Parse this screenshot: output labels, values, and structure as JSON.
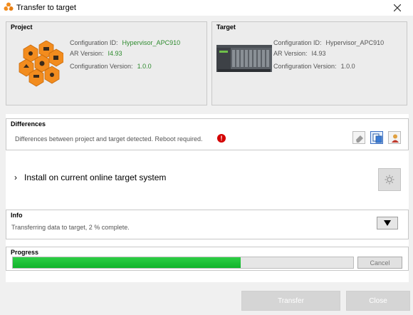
{
  "window": {
    "title": "Transfer to target"
  },
  "project": {
    "heading": "Project",
    "config_id_label": "Configuration ID:",
    "config_id_value": "Hypervisor_APC910",
    "ar_version_label": "AR Version:",
    "ar_version_value": "I4.93",
    "config_version_label": "Configuration Version:",
    "config_version_value": "1.0.0"
  },
  "target": {
    "heading": "Target",
    "config_id_label": "Configuration ID:",
    "config_id_value": "Hypervisor_APC910",
    "ar_version_label": "AR Version:",
    "ar_version_value": "I4.93",
    "config_version_label": "Configuration Version:",
    "config_version_value": "1.0.0"
  },
  "differences": {
    "heading": "Differences",
    "message": "Differences between project and target detected. Reboot required."
  },
  "install": {
    "chevron": "›",
    "label": "Install on current online target system"
  },
  "info": {
    "heading": "Info",
    "message": "Transferring data to target, 2 % complete."
  },
  "progress": {
    "heading": "Progress",
    "fill_fraction": 0.67,
    "cancel_label": "Cancel"
  },
  "buttons": {
    "transfer_label": "Transfer",
    "close_label": "Close"
  },
  "colors": {
    "progress_green": "#1dbf37",
    "accent_orange": "#f28c1e",
    "value_green": "#2e8b2e"
  }
}
